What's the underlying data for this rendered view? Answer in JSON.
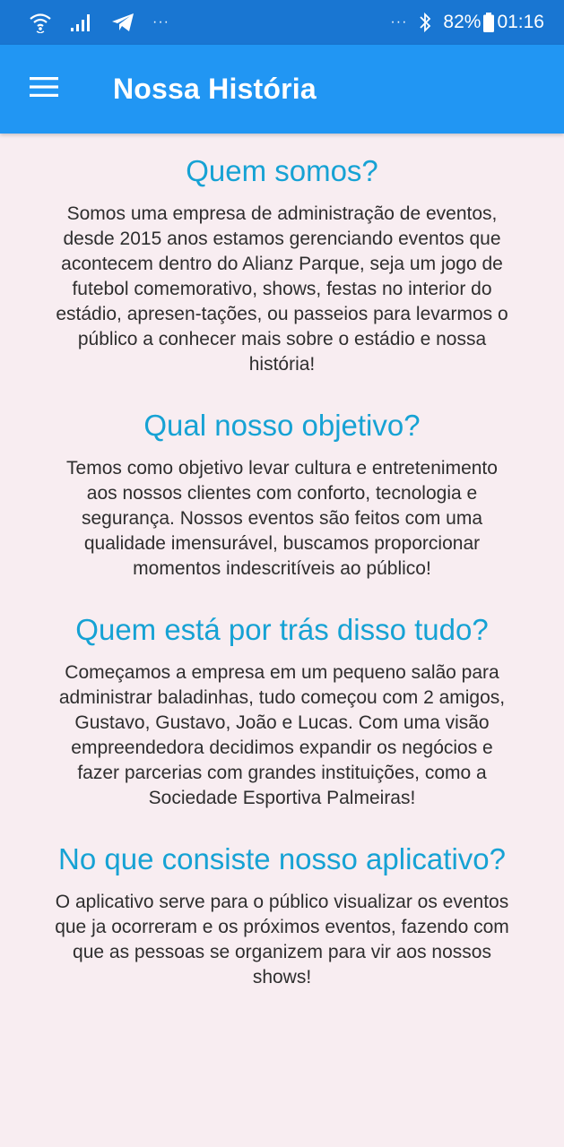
{
  "status_bar": {
    "dots_left": "···",
    "dots_right": "···",
    "battery": "82%",
    "time": "01:16",
    "icons": [
      "wifi-icon",
      "signal-icon",
      "telegram-icon",
      "bluetooth-icon",
      "battery-icon"
    ]
  },
  "app_bar": {
    "title": "Nossa História",
    "menu_icon": "hamburger-menu-icon",
    "background": "#2196f3"
  },
  "colors": {
    "status_bar": "#1976d2",
    "heading": "#16a2d4",
    "page_background": "#f8edf1"
  },
  "sections": [
    {
      "heading": "Quem somos?",
      "body": "Somos uma empresa de administração de eventos, desde 2015 anos estamos gerenciando eventos que acontecem dentro do Alianz Parque, seja um jogo de futebol comemorativo, shows, festas no interior do estádio, apresen-tações, ou passeios para levarmos o público a conhecer mais sobre o estádio e nossa história!"
    },
    {
      "heading": "Qual nosso objetivo?",
      "body": "Temos como objetivo levar cultura e entretenimento aos nossos clientes com conforto, tecnologia e segurança. Nossos eventos são feitos com uma qualidade imensurável, buscamos proporcionar momentos indescritíveis ao público!"
    },
    {
      "heading": "Quem está por trás disso tudo?",
      "body": "Começamos a empresa em um pequeno salão para administrar baladinhas, tudo começou com 2 amigos, Gustavo, Gustavo, João e Lucas. Com uma visão empreendedora decidimos expandir os negócios e fazer parcerias com grandes instituições, como a Sociedade Esportiva Palmeiras!"
    },
    {
      "heading": "No que consiste nosso aplicativo?",
      "body": "O aplicativo serve para o público visualizar os eventos que ja ocorreram e os próximos eventos, fazendo com que as pessoas se organizem para vir aos nossos shows!"
    }
  ]
}
